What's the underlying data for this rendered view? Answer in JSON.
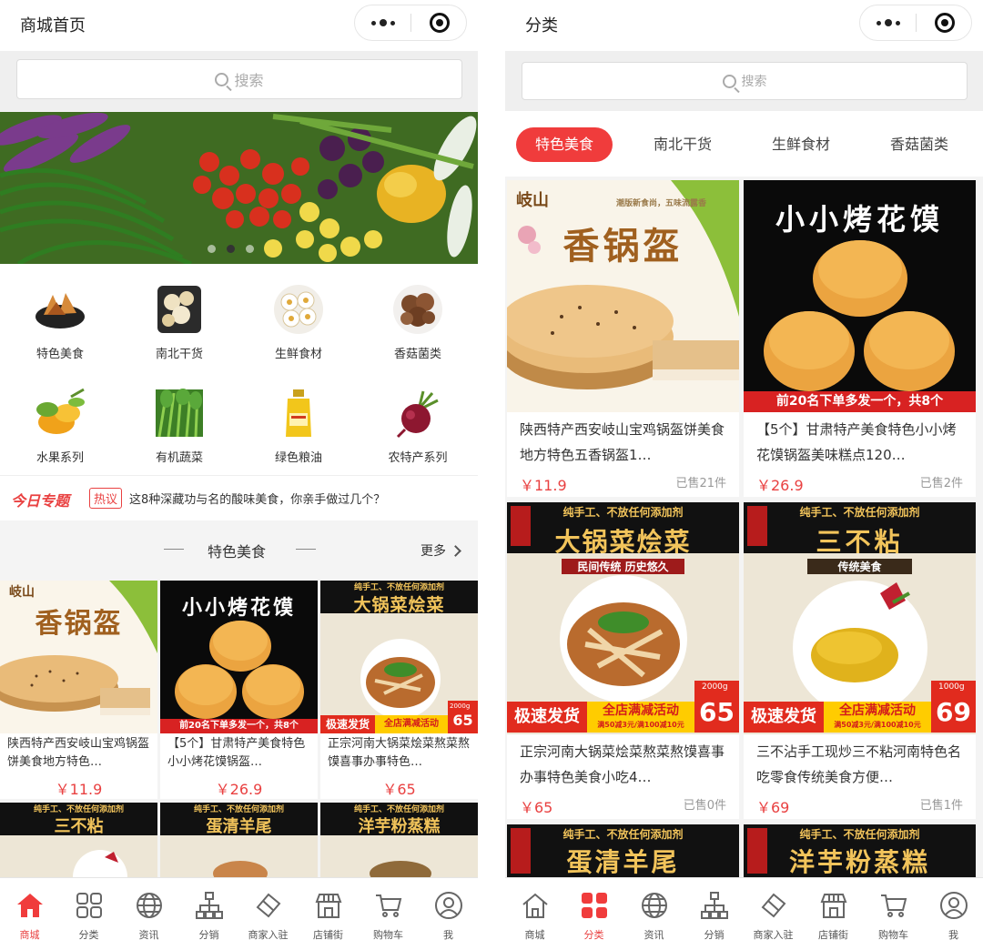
{
  "left": {
    "title": "商城首页",
    "search_placeholder": "搜索",
    "categories": [
      {
        "label": "特色美食",
        "icon": "snack-dish-icon"
      },
      {
        "label": "南北干货",
        "icon": "dried-goods-icon"
      },
      {
        "label": "生鲜食材",
        "icon": "fresh-food-icon"
      },
      {
        "label": "香菇菌类",
        "icon": "mushroom-icon"
      },
      {
        "label": "水果系列",
        "icon": "fruit-icon"
      },
      {
        "label": "有机蔬菜",
        "icon": "vegetable-icon"
      },
      {
        "label": "绿色粮油",
        "icon": "oil-bottle-icon"
      },
      {
        "label": "农特产系列",
        "icon": "beet-icon"
      }
    ],
    "today": {
      "logo": "今日专题",
      "hot": "热议",
      "text": "这8种深藏功与名的酸味美食，你亲手做过几个？"
    },
    "section": {
      "title": "特色美食",
      "more": "更多"
    },
    "products": [
      {
        "name": "陕西特产西安岐山宝鸡锅盔饼美食地方特色…",
        "price": "￥11.9",
        "poster": {
          "title": "香锅盔",
          "sub": "岐山"
        }
      },
      {
        "name": "【5个】甘肃特产美食特色小小烤花馍锅盔…",
        "price": "￥26.9",
        "poster": {
          "title": "小小烤花馍",
          "bar": "前20名下单多发一个，共8个"
        }
      },
      {
        "name": "正宗河南大锅菜烩菜熬菜熬馍喜事办事特色…",
        "price": "￥65",
        "poster": {
          "title": "大锅菜烩菜",
          "top": "纯手工、不放任何添加剂",
          "fast": "极速发货",
          "promo": "全店满减活动",
          "num": "65",
          "weight": "2000g"
        }
      }
    ],
    "next_row": [
      {
        "title": "三不粘",
        "top": "纯手工、不放任何添加剂"
      },
      {
        "title": "蛋清羊尾",
        "top": "纯手工、不放任何添加剂"
      },
      {
        "title": "洋芋粉蒸糕",
        "top": "纯手工、不放任何添加剂"
      }
    ]
  },
  "right": {
    "title": "分类",
    "search_placeholder": "搜索",
    "tabs": [
      "特色美食",
      "南北干货",
      "生鲜食材",
      "香菇菌类"
    ],
    "products": [
      {
        "name": "陕西特产西安岐山宝鸡锅盔饼美食地方特色五香锅盔1…",
        "price": "￥11.9",
        "sold": "已售21件",
        "poster": {
          "title": "香锅盔",
          "sub": "岐山",
          "tag": "潮版新食尚，五味流露香"
        }
      },
      {
        "name": "【5个】甘肃特产美食特色小小烤花馍锅盔美味糕点120…",
        "price": "￥26.9",
        "sold": "已售2件",
        "poster": {
          "title": "小小烤花馍",
          "bar": "前20名下单多发一个，共8个"
        }
      },
      {
        "name": "正宗河南大锅菜烩菜熬菜熬馍喜事办事特色美食小吃4…",
        "price": "￥65",
        "sold": "已售0件",
        "poster": {
          "title": "大锅菜烩菜",
          "top": "纯手工、不放任何添加剂",
          "sub": "民间传统 历史悠久",
          "fast": "极速发货",
          "promo": "全店满减活动",
          "promo_sub": "满50减3元/满100减10元",
          "num": "65",
          "weight": "2000g"
        }
      },
      {
        "name": "三不沾手工现炒三不粘河南特色名吃零食传统美食方便…",
        "price": "￥69",
        "sold": "已售1件",
        "poster": {
          "title": "三不粘",
          "top": "纯手工、不放任何添加剂",
          "sub": "传统美食",
          "fast": "极速发货",
          "promo": "全店满减活动",
          "promo_sub": "满50减3元/满100减10元",
          "num": "69",
          "weight": "1000g"
        }
      }
    ],
    "next_row": [
      {
        "title": "蛋清羊尾",
        "top": "纯手工、不放任何添加剂"
      },
      {
        "title": "洋芋粉蒸糕",
        "top": "纯手工、不放任何添加剂"
      }
    ]
  },
  "tabbar": [
    {
      "label": "商城",
      "icon": "home-icon"
    },
    {
      "label": "分类",
      "icon": "category-grid-icon"
    },
    {
      "label": "资讯",
      "icon": "globe-icon"
    },
    {
      "label": "分销",
      "icon": "hierarchy-icon"
    },
    {
      "label": "商家入驻",
      "icon": "ticket-icon"
    },
    {
      "label": "店铺街",
      "icon": "storefront-icon"
    },
    {
      "label": "购物车",
      "icon": "cart-icon"
    },
    {
      "label": "我",
      "icon": "user-icon"
    }
  ],
  "colors": {
    "accent": "#e94141",
    "tab_active": "#f03c3c",
    "poster_red": "#d82222",
    "promo_yellow": "#ffcc00"
  }
}
